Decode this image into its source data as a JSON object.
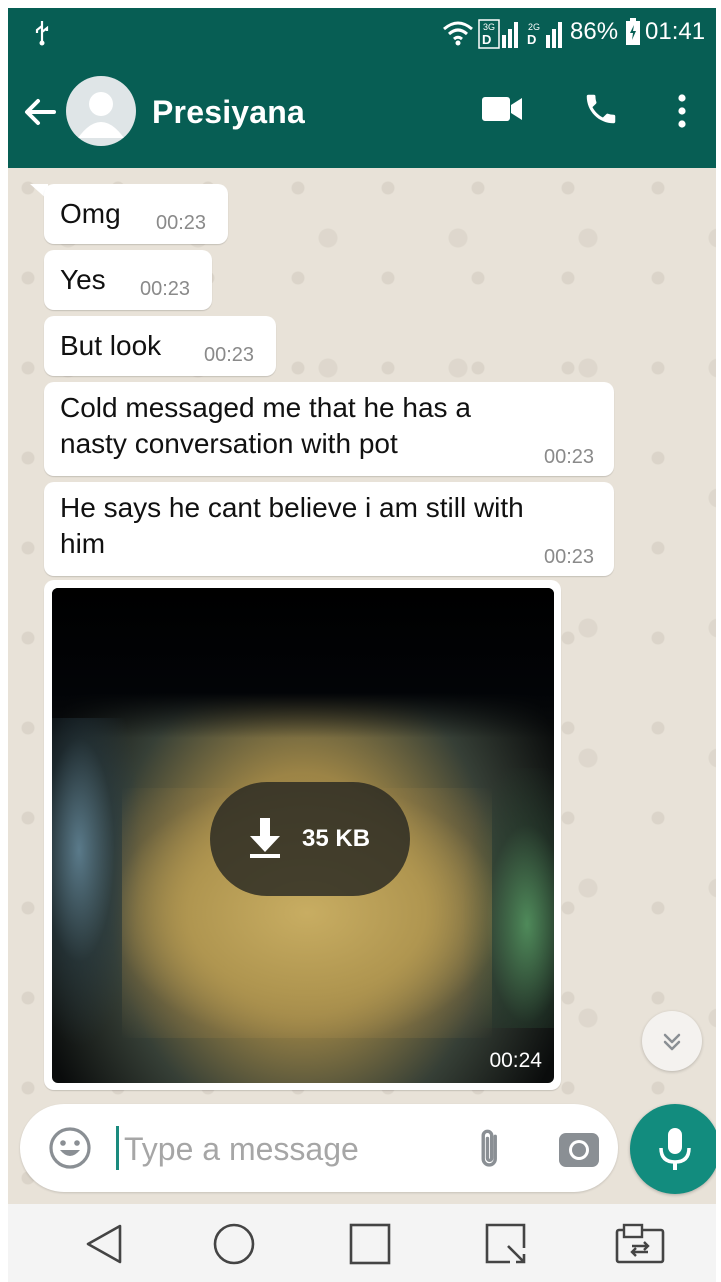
{
  "status_bar": {
    "battery_percent": "86%",
    "time": "01:41",
    "sim1_label": "3G",
    "sim2_label": "2G",
    "icons": [
      "usb-icon",
      "wifi-icon",
      "signal-icon",
      "signal-icon",
      "battery-icon"
    ]
  },
  "header": {
    "contact_name": "Presiyana",
    "icons": [
      "back-arrow-icon",
      "avatar-placeholder-icon",
      "video-camera-icon",
      "phone-icon",
      "more-vertical-icon"
    ],
    "color": "#075e54"
  },
  "messages": [
    {
      "text": "Omg",
      "time": "00:23"
    },
    {
      "text": "Yes",
      "time": "00:23"
    },
    {
      "text": "But look",
      "time": "00:23"
    },
    {
      "text": "Cold messaged me that he has a nasty conversation with pot",
      "line1": "Cold messaged me that he has a",
      "line2": "nasty conversation with pot",
      "time": "00:23"
    },
    {
      "text": "He says he cant believe i am still with him",
      "line1": "He says he cant believe i am still with",
      "line2": "him",
      "time": "00:23"
    }
  ],
  "media_message": {
    "download_size": "35 KB",
    "time": "00:24",
    "icons": [
      "download-arrow-icon"
    ]
  },
  "composer": {
    "placeholder": "Type a message",
    "value": "",
    "icons": [
      "emoji-icon",
      "paperclip-icon",
      "camera-icon",
      "microphone-icon"
    ],
    "accent": "#128c7e"
  },
  "navigation": {
    "icons": [
      "back-triangle-icon",
      "home-circle-icon",
      "recents-square-icon",
      "screenshot-icon",
      "switch-windows-icon"
    ]
  },
  "colors": {
    "chat_background": "#e8e2d8",
    "bubble": "#ffffff",
    "timestamp": "#8a8a8a"
  }
}
